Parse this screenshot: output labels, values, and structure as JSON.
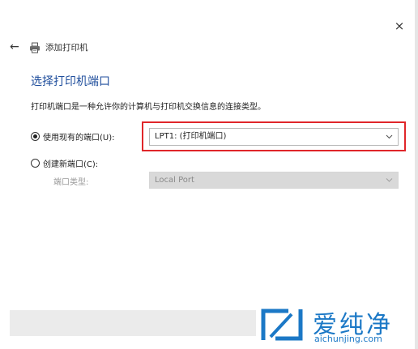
{
  "window": {
    "close_symbol": "×"
  },
  "header": {
    "back_symbol": "←",
    "icon": "printer-icon",
    "title": "添加打印机"
  },
  "page": {
    "title": "选择打印机端口",
    "description": "打印机端口是一种允许你的计算机与打印机交换信息的连接类型。"
  },
  "options": {
    "existing_port": {
      "label": "使用现有的端口(U):",
      "checked": true,
      "selected_value": "LPT1: (打印机端口)"
    },
    "new_port": {
      "label": "创建新端口(C):",
      "checked": false,
      "type_label": "端口类型:",
      "selected_value": "Local Port"
    }
  },
  "watermark": {
    "brand": "爱纯净",
    "url": "aichunjing.com"
  },
  "colors": {
    "title_blue": "#1f4e9c",
    "highlight_red": "#e0262a",
    "watermark_blue": "#1b78c6"
  }
}
